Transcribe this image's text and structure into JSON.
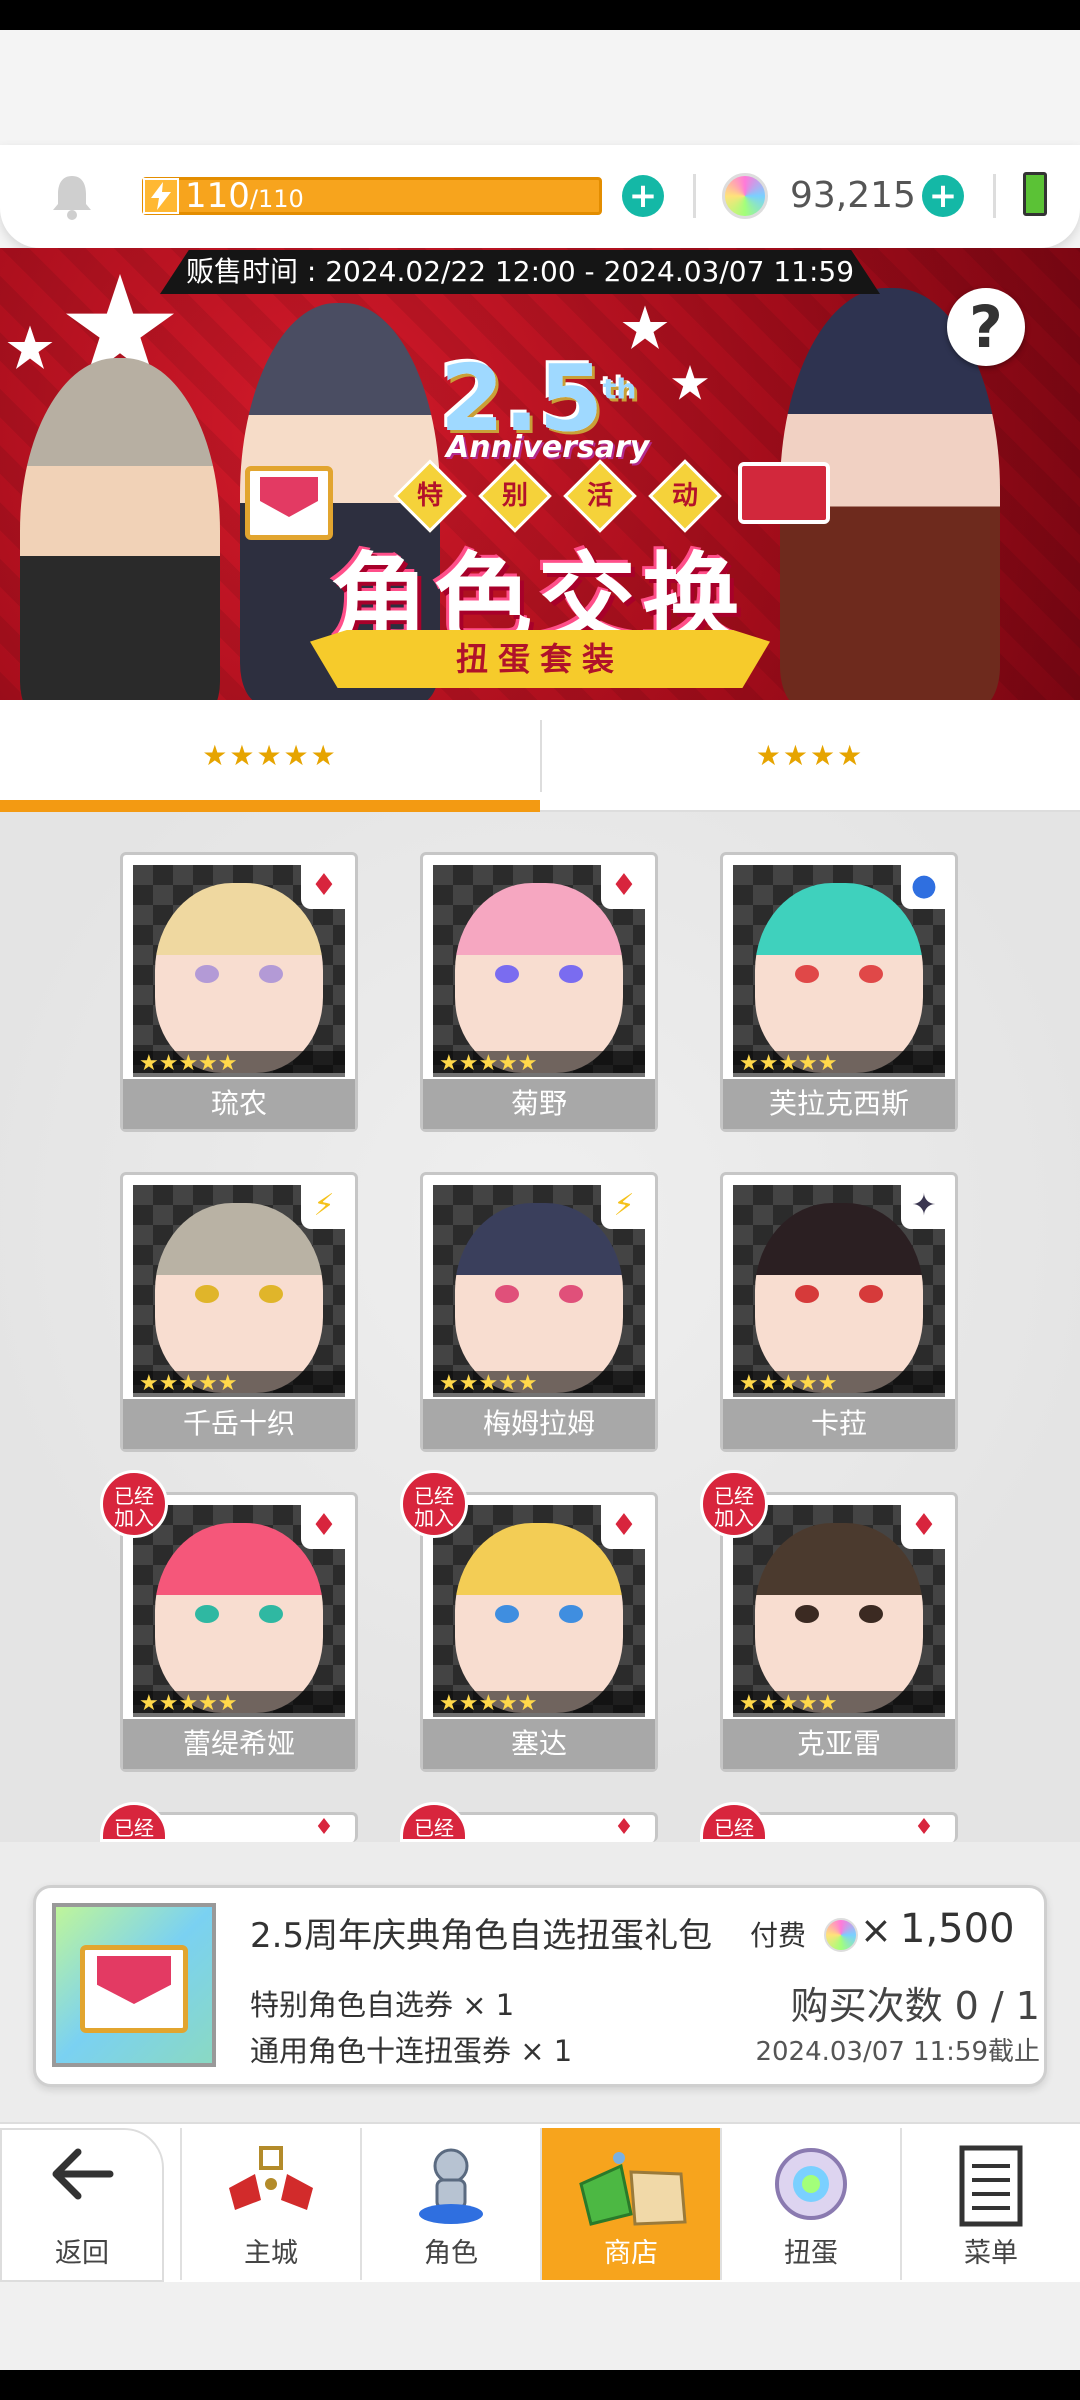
{
  "topbar": {
    "stamina_current": "110",
    "stamina_max": "/110",
    "gem_count": "93,215",
    "icons": [
      "bell-icon",
      "lightning-icon",
      "plus-icon",
      "rainbow-gem-icon",
      "battery-icon"
    ]
  },
  "banner": {
    "sale_time": "贩售时间 : 2024.02/22 12:00 - 2024.03/07 11:59",
    "anniversary_number": "2.5",
    "anniversary_sup": "th",
    "anniversary_word": "Anniversary",
    "tags": [
      "特",
      "别",
      "活",
      "动"
    ],
    "title": "角色交换",
    "subtitle": "扭蛋套装",
    "help": "?"
  },
  "tabs": [
    {
      "label": "★★★★★",
      "active": true
    },
    {
      "label": "★★★★",
      "active": false
    }
  ],
  "characters": [
    {
      "name": "琉农",
      "stars": "★★★★★",
      "element": "♦",
      "element_color": "#d8253d",
      "joined": false,
      "hair": "#efd8a0",
      "eye": "#b39ad6"
    },
    {
      "name": "菊野",
      "stars": "★★★★★",
      "element": "♦",
      "element_color": "#d8253d",
      "joined": false,
      "hair": "#f6a7c1",
      "eye": "#7a6cf0"
    },
    {
      "name": "芙拉克西斯",
      "stars": "★★★★★",
      "element": "●",
      "element_color": "#2f6fe0",
      "joined": false,
      "hair": "#3fd1bd",
      "eye": "#e04848"
    },
    {
      "name": "千岳十织",
      "stars": "★★★★★",
      "element": "⚡",
      "element_color": "#f5c21b",
      "joined": false,
      "hair": "#b9b2a4",
      "eye": "#e0b52a"
    },
    {
      "name": "梅姆拉姆",
      "stars": "★★★★★",
      "element": "⚡",
      "element_color": "#f5c21b",
      "joined": false,
      "hair": "#3a3f5c",
      "eye": "#e0507a"
    },
    {
      "name": "卡菈",
      "stars": "★★★★★",
      "element": "✦",
      "element_color": "#3a3650",
      "joined": false,
      "hair": "#2b1f22",
      "eye": "#d63a3a"
    },
    {
      "name": "蕾缇希娅",
      "stars": "★★★★★",
      "element": "♦",
      "element_color": "#d8253d",
      "joined": true,
      "hair": "#f5577a",
      "eye": "#2fb8a2"
    },
    {
      "name": "塞达",
      "stars": "★★★★★",
      "element": "♦",
      "element_color": "#d8253d",
      "joined": true,
      "hair": "#f3cd55",
      "eye": "#3f8ee0"
    },
    {
      "name": "克亚雷",
      "stars": "★★★★★",
      "element": "♦",
      "element_color": "#d8253d",
      "joined": true,
      "hair": "#4b3a2e",
      "eye": "#3b2a22"
    }
  ],
  "joined_label_line1": "已经",
  "joined_label_line2": "加入",
  "partial_row": [
    {
      "element": "♦",
      "joined": true
    },
    {
      "element": "♦",
      "joined": true
    },
    {
      "element": "♦",
      "joined": true
    }
  ],
  "product": {
    "name": "2.5周年庆典角色自选扭蛋礼包",
    "price_label": "付费",
    "price_x": "×",
    "price_value": "1,500",
    "content_line1": "特别角色自选券 × 1",
    "content_line2": "通用角色十连扭蛋券 × 1",
    "purchase_count": "购买次数 0 / 1",
    "deadline": "2024.03/07 11:59截止"
  },
  "nav": {
    "back": "返回",
    "items": [
      {
        "label": "主城",
        "icon": "castle-icon",
        "active": false
      },
      {
        "label": "角色",
        "icon": "character-icon",
        "active": false
      },
      {
        "label": "商店",
        "icon": "shop-icon",
        "active": true
      },
      {
        "label": "扭蛋",
        "icon": "gacha-icon",
        "active": false
      },
      {
        "label": "菜单",
        "icon": "menu-icon",
        "active": false
      }
    ]
  },
  "colors": {
    "accent": "#f7a41d",
    "teal": "#14b8a6",
    "banner_red": "#c8142a",
    "joined_badge": "#d8253d"
  }
}
